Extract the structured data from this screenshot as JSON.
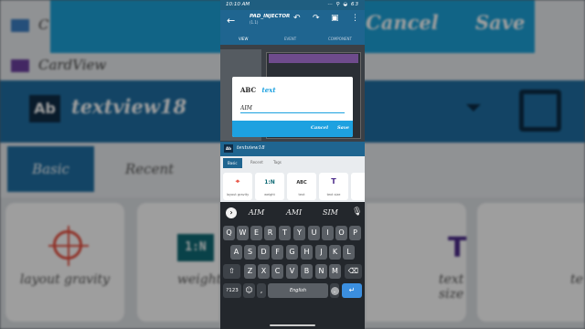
{
  "background": {
    "dialog_cancel": "Cancel",
    "dialog_save": "Save",
    "list_item_top": "C",
    "list_item_cardview": "CardView",
    "widget_icon": "Ab",
    "widget_name": "textview18",
    "tab_basic": "Basic",
    "tab_recent": "Recent",
    "card_layout_gravity": "layout gravity",
    "card_weight_icon": "1:N",
    "card_weight": "weight",
    "card_text_size_icon": "T",
    "card_text_size": "text size",
    "card_text_partial": "te"
  },
  "status_bar": {
    "time": "10:10 AM",
    "icons": "⋯ ⚲ ◒ 63"
  },
  "appbar": {
    "title": "PAD_INJECTOR",
    "subtitle": "(1.1)",
    "tabs": [
      "VIEW",
      "EVENT",
      "COMPONENT"
    ]
  },
  "dialog": {
    "abc": "ABC",
    "label": "text",
    "value": "AIM",
    "cancel": "Cancel",
    "save": "Save"
  },
  "panel": {
    "icon": "Ab",
    "name": "textview18",
    "tabs": [
      "Basic",
      "Recent",
      "Tags"
    ],
    "cards": [
      {
        "icon": "⌖",
        "caption": "layout gravity"
      },
      {
        "icon": "1:N",
        "caption": "weight"
      },
      {
        "icon": "ABC",
        "caption": "text"
      },
      {
        "icon": "T",
        "caption": "text size"
      }
    ]
  },
  "keyboard": {
    "suggestions": [
      "AIM",
      "AMI",
      "SIM"
    ],
    "row1": [
      "Q",
      "W",
      "E",
      "R",
      "T",
      "Y",
      "U",
      "I",
      "O",
      "P"
    ],
    "row2": [
      "A",
      "S",
      "D",
      "F",
      "G",
      "H",
      "J",
      "K",
      "L"
    ],
    "row3": [
      "Z",
      "X",
      "C",
      "V",
      "B",
      "N",
      "M"
    ],
    "symbols": "?123",
    "comma": ",",
    "space": "English",
    "period": "."
  },
  "colors": {
    "accent": "#1da1e0",
    "appbar": "#1f6590",
    "enter": "#3b8fe0"
  }
}
